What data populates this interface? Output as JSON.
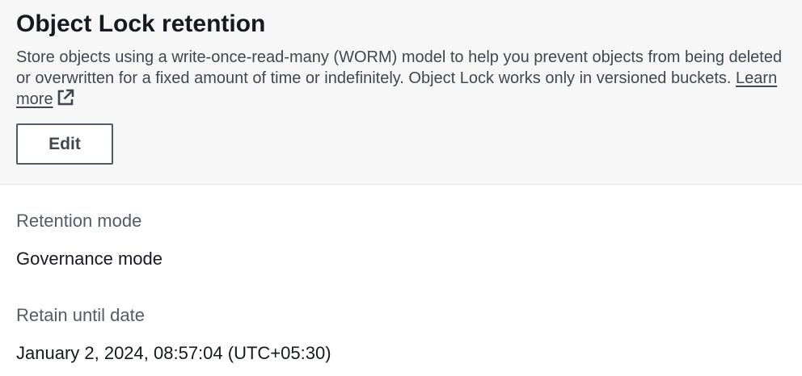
{
  "panel": {
    "title": "Object Lock retention",
    "description": "Store objects using a write-once-read-many (WORM) model to help you prevent objects from being deleted or overwritten for a fixed amount of time or indefinitely. Object Lock works only in versioned buckets.",
    "learn_more_label": "Learn more",
    "learn_more_icon": "external-link-icon",
    "edit_label": "Edit"
  },
  "fields": {
    "retention_mode_label": "Retention mode",
    "retention_mode_value": "Governance mode",
    "retain_until_label": "Retain until date",
    "retain_until_value": "January 2, 2024, 08:57:04 (UTC+05:30)"
  }
}
